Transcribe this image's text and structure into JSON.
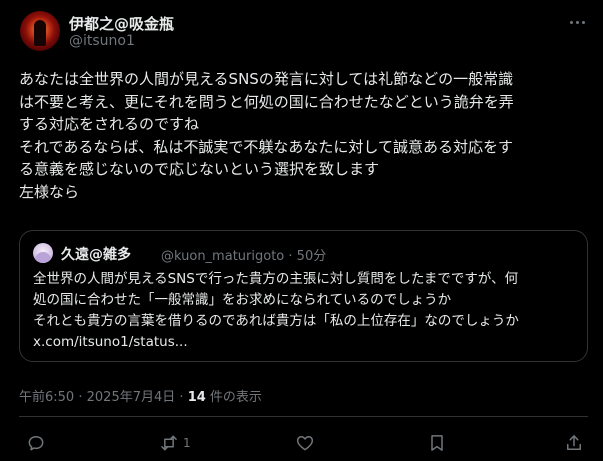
{
  "author": {
    "display_name": "伊都之@吸金瓶",
    "handle": "@itsuno1"
  },
  "post": {
    "lines": [
      "あなたは全世界の人間が見えるSNSの発言に対しては礼節などの一般常識",
      "は不要と考え、更にそれを問うと何処の国に合わせたなどという詭弁を弄",
      "する対応をされるのですね",
      "それであるならば、私は不誠実で不躾なあなたに対して誠意ある対応をす",
      "る意義を感じないので応じないという選択を致します",
      "左様なら"
    ]
  },
  "quote": {
    "display_name": "久遠@雑多",
    "handle": "@kuon_maturigoto",
    "separator": "·",
    "time_ago": "50分",
    "lines": [
      "全世界の人間が見えるSNSで行った貴方の主張に対し質問をしたまでですが、何",
      "処の国に合わせた「一般常識」をお求めになられているのでしょうか",
      "それとも貴方の言葉を借りるのであれば貴方は「私の上位存在」なのでしょうか",
      "x.com/itsuno1/status..."
    ]
  },
  "meta": {
    "time": "午前6:50",
    "separator1": "·",
    "date": "2025年7月4日",
    "separator2": "·",
    "views_count": "14",
    "views_label": "件の表示"
  },
  "actions": {
    "reply": {
      "icon": "reply-icon",
      "count": ""
    },
    "repost": {
      "icon": "repost-icon",
      "count": "1"
    },
    "like": {
      "icon": "heart-icon",
      "count": ""
    },
    "bookmark": {
      "icon": "bookmark-icon",
      "count": ""
    },
    "share": {
      "icon": "share-icon",
      "count": ""
    }
  },
  "colors": {
    "background": "#000000",
    "text": "#e7e9ea",
    "secondary_text": "#71767b",
    "border": "#2f3336"
  }
}
